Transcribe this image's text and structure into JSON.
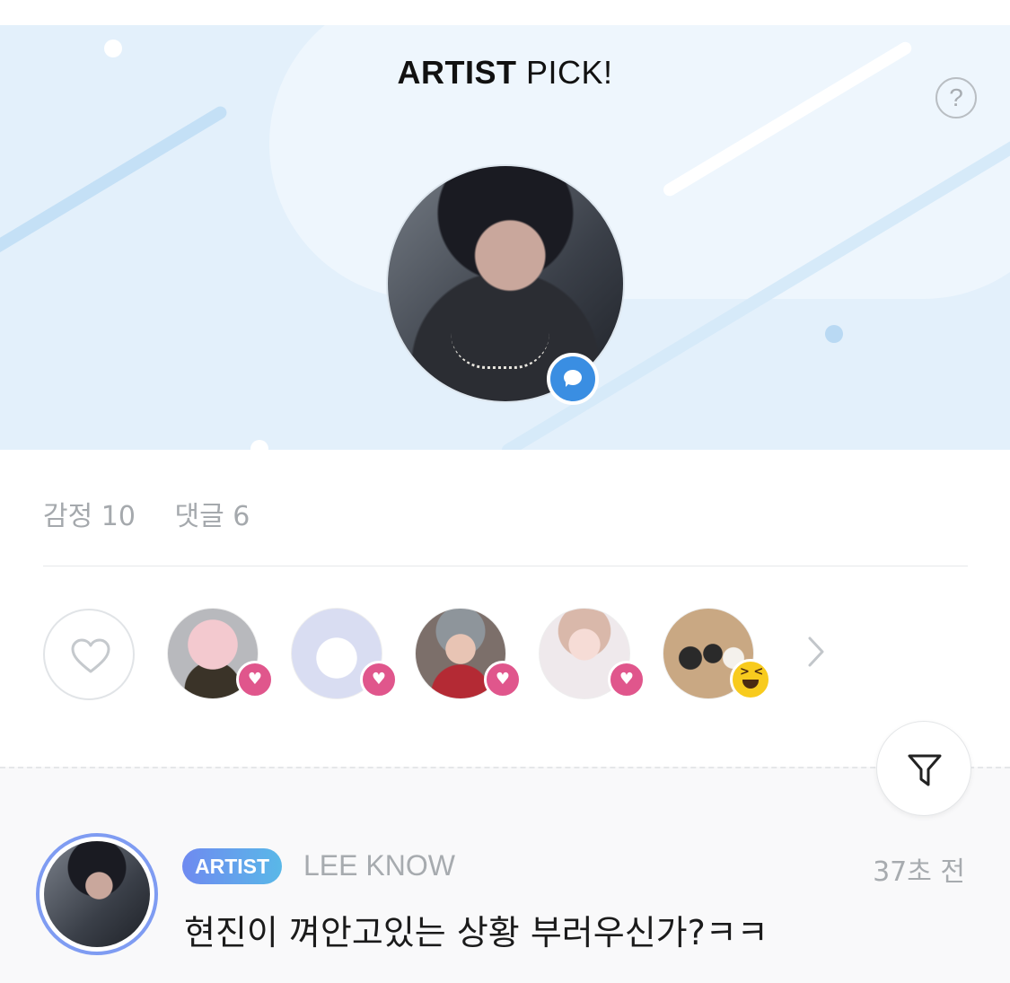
{
  "banner": {
    "title_bold": "ARTIST",
    "title_rest": "PICK!",
    "help_glyph": "?"
  },
  "stats": {
    "emotions": "감정 10",
    "comments": "댓글 6"
  },
  "reactions": {
    "users": [
      "reactor-1",
      "reactor-2",
      "reactor-3",
      "reactor-4",
      "reactor-5"
    ],
    "icons": [
      "heart-icon",
      "heart-icon",
      "heart-icon",
      "heart-icon",
      "laughing-emoji-icon"
    ],
    "accent_heart": "#e0568c",
    "accent_laugh": "#f8cb1e"
  },
  "comment": {
    "badge": "ARTIST",
    "author": "LEE KNOW",
    "time": "37초 전",
    "text": "현진이 껴안고있는 상황 부러우신가?ㅋㅋ"
  },
  "colors": {
    "banner_bg": "#e3f0fb",
    "chat_badge": "#3a8ee2",
    "artist_tag_start": "#6f8af0",
    "artist_tag_end": "#59b8e8"
  }
}
